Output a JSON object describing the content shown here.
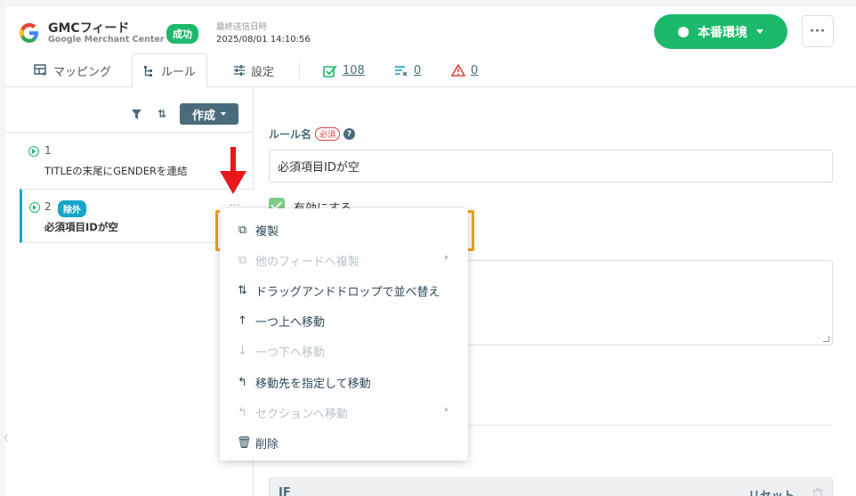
{
  "header": {
    "app_title": "GMCフィード",
    "app_subtitle": "Google Merchant Center",
    "status": "成功",
    "last_sent_label": "最終送信日時",
    "last_sent_value": "2025/08/01 14:10:56",
    "env_label": "本番環境",
    "more": "···"
  },
  "tabs": [
    {
      "label": "マッピング"
    },
    {
      "label": "ルール"
    },
    {
      "label": "設定"
    }
  ],
  "counts": {
    "ok": "108",
    "warn": "0",
    "error": "0"
  },
  "toolbar": {
    "create_label": "作成",
    "sort_symbol": "⇅"
  },
  "rules": [
    {
      "number": "1",
      "name": "TITLEの末尾にGENDERを連結"
    },
    {
      "number": "2",
      "badge": "除外",
      "name": "必須項目IDが空"
    }
  ],
  "row_more": "···",
  "form": {
    "name_label": "ルール名",
    "required_badge": "必須",
    "help": "?",
    "name_value": "必須項目IDが空",
    "enable_label": "有効にする"
  },
  "condition": {
    "if_label": "IF",
    "reset_label": "リセット"
  },
  "menu": [
    {
      "label": "複製",
      "icon": "⧉",
      "disabled": false
    },
    {
      "label": "他のフィードへ複製",
      "icon": "⧉",
      "disabled": true
    },
    {
      "label": "ドラッグアンドドロップで並べ替え",
      "icon": "⇅",
      "disabled": false
    },
    {
      "label": "一つ上へ移動",
      "icon": "↑",
      "disabled": false
    },
    {
      "label": "一つ下へ移動",
      "icon": "↓",
      "disabled": true
    },
    {
      "label": "移動先を指定して移動",
      "icon": "↰",
      "disabled": false
    },
    {
      "label": "セクションへ移動",
      "icon": "↰",
      "disabled": true
    },
    {
      "label": "削除",
      "icon": "🗑",
      "disabled": false
    }
  ],
  "colors": {
    "brand_green": "#1cb96b",
    "accent_slate": "#4a6b7a",
    "exclude_blue": "#19a4c9",
    "highlight_orange": "#f3a012",
    "arrow_red": "#e8171a"
  },
  "edge_glyph": "〈"
}
